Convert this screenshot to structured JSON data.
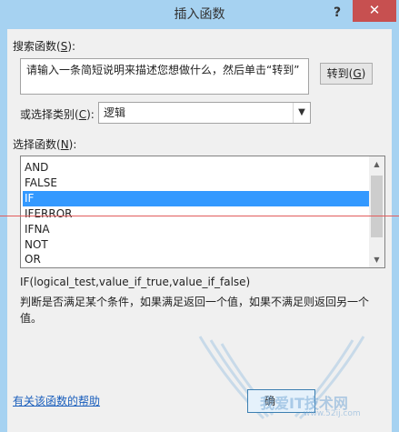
{
  "window": {
    "title": "插入函数",
    "help_glyph": "?",
    "close_glyph": "✕"
  },
  "search": {
    "label": "搜索函数(",
    "label_key": "S",
    "label_end": "):",
    "value": "请输入一条简短说明来描述您想做什么，然后单击“转到”",
    "goto_label": "转到(",
    "goto_key": "G",
    "goto_end": ")"
  },
  "category": {
    "label": "或选择类别(",
    "label_key": "C",
    "label_end": "):",
    "selected": "逻辑",
    "arrow_icon": "chevron-down-icon"
  },
  "functions": {
    "label": "选择函数(",
    "label_key": "N",
    "label_end": "):",
    "items": [
      {
        "name": "AND",
        "selected": false
      },
      {
        "name": "FALSE",
        "selected": false
      },
      {
        "name": "IF",
        "selected": true
      },
      {
        "name": "IFERROR",
        "selected": false
      },
      {
        "name": "IFNA",
        "selected": false
      },
      {
        "name": "NOT",
        "selected": false
      },
      {
        "name": "OR",
        "selected": false
      }
    ],
    "scroll_up_glyph": "▲",
    "scroll_down_glyph": "▼"
  },
  "details": {
    "syntax": "IF(logical_test,value_if_true,value_if_false)",
    "description": "判断是否满足某个条件，如果满足返回一个值，如果不满足则返回另一个值。"
  },
  "footer": {
    "help_link": "有关该函数的帮助",
    "ok_label": "确"
  },
  "watermark": {
    "text": "我爱IT技术网",
    "url": "www.52ij.com"
  },
  "colors": {
    "frame": "#a6d2f1",
    "close": "#c75050",
    "selection": "#3399ff",
    "link": "#1a5ebc",
    "annotation_line": "#e25c5c"
  }
}
